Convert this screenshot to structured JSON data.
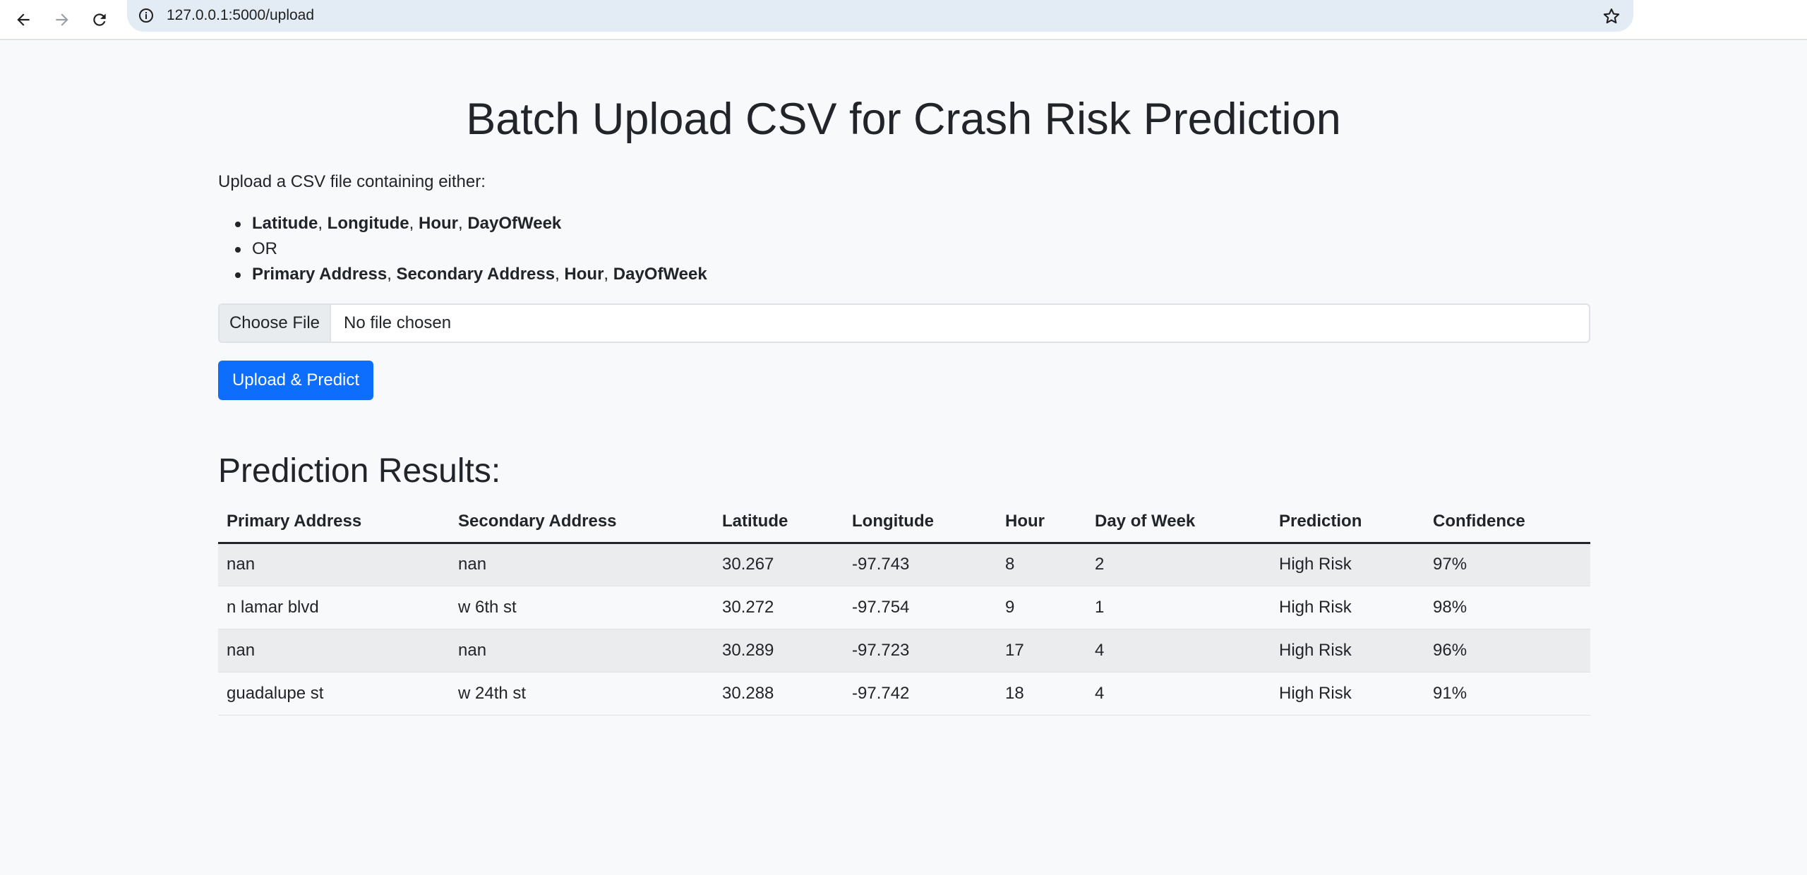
{
  "browser": {
    "url": "127.0.0.1:5000/upload"
  },
  "page": {
    "title": "Batch Upload CSV for Crash Risk Prediction",
    "intro": "Upload a CSV file containing either:",
    "options": [
      {
        "parts": [
          {
            "text": "Latitude",
            "bold": true
          },
          {
            "text": ", ",
            "bold": false
          },
          {
            "text": "Longitude",
            "bold": true
          },
          {
            "text": ", ",
            "bold": false
          },
          {
            "text": "Hour",
            "bold": true
          },
          {
            "text": ", ",
            "bold": false
          },
          {
            "text": "DayOfWeek",
            "bold": true
          }
        ]
      },
      {
        "parts": [
          {
            "text": "OR",
            "bold": false
          }
        ]
      },
      {
        "parts": [
          {
            "text": "Primary Address",
            "bold": true
          },
          {
            "text": ", ",
            "bold": false
          },
          {
            "text": "Secondary Address",
            "bold": true
          },
          {
            "text": ", ",
            "bold": false
          },
          {
            "text": "Hour",
            "bold": true
          },
          {
            "text": ", ",
            "bold": false
          },
          {
            "text": "DayOfWeek",
            "bold": true
          }
        ]
      }
    ],
    "file_input": {
      "button_label": "Choose File",
      "status": "No file chosen"
    },
    "submit_label": "Upload & Predict"
  },
  "results": {
    "title": "Prediction Results:",
    "columns": [
      "Primary Address",
      "Secondary Address",
      "Latitude",
      "Longitude",
      "Hour",
      "Day of Week",
      "Prediction",
      "Confidence"
    ],
    "rows": [
      [
        "nan",
        "nan",
        "30.267",
        "-97.743",
        "8",
        "2",
        "High Risk",
        "97%"
      ],
      [
        "n lamar blvd",
        "w 6th st",
        "30.272",
        "-97.754",
        "9",
        "1",
        "High Risk",
        "98%"
      ],
      [
        "nan",
        "nan",
        "30.289",
        "-97.723",
        "17",
        "4",
        "High Risk",
        "96%"
      ],
      [
        "guadalupe st",
        "w 24th st",
        "30.288",
        "-97.742",
        "18",
        "4",
        "High Risk",
        "91%"
      ]
    ]
  },
  "colors": {
    "primary": "#0d6efd",
    "page_background": "#f8f9fa",
    "omnibox_background": "#e3ebf4"
  }
}
